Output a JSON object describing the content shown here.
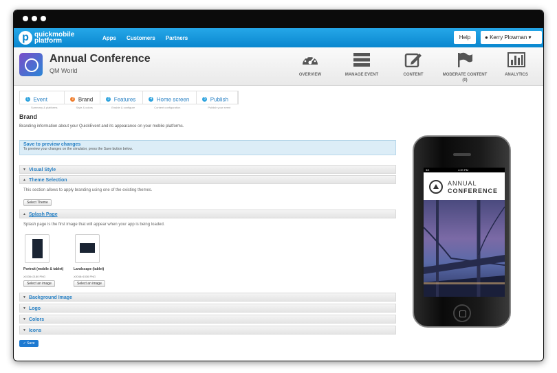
{
  "nav": {
    "logo_text_1": "quickmobile",
    "logo_text_2": "platform",
    "links": [
      "Apps",
      "Customers",
      "Partners"
    ],
    "help": "Help",
    "user": "Kerry Plowman ▾"
  },
  "header": {
    "title": "Annual Conference",
    "subtitle": "QM World",
    "nav": [
      {
        "label": "OVERVIEW",
        "icon": "gauge-icon"
      },
      {
        "label": "MANAGE EVENT",
        "icon": "list-icon"
      },
      {
        "label": "CONTENT",
        "icon": "pencil-icon"
      },
      {
        "label": "MODERATE CONTENT (0)",
        "icon": "flag-icon"
      },
      {
        "label": "ANALYTICS",
        "icon": "bar-chart-icon"
      }
    ]
  },
  "steps": [
    {
      "num": "1",
      "title": "Event",
      "sub": "Summary & platforms"
    },
    {
      "num": "2",
      "title": "Brand",
      "sub": "Style & colors"
    },
    {
      "num": "3",
      "title": "Features",
      "sub": "Enable & configure"
    },
    {
      "num": "4",
      "title": "Home screen",
      "sub": "Content configuration"
    },
    {
      "num": "5",
      "title": "Publish",
      "sub": "Publish your event"
    }
  ],
  "brand": {
    "heading": "Brand",
    "description": "Branding information about your QuickEvent and its appearance on your mobile platforms.",
    "preview_title": "Save to preview changes",
    "preview_text": "To preview your changes on the simulator, press the Save button below."
  },
  "sections": {
    "visual_style": "Visual Style",
    "theme_selection": "Theme Selection",
    "theme_text": "This section allows to apply branding using one of the existing themes.",
    "select_theme": "Select Theme",
    "splash_page": "Splash Page",
    "splash_text": "Splash page is the first image that will appear when your app is being loaded.",
    "portrait_label": "Portrait (mobile & tablet)",
    "portrait_size": "≥1536×2180 PNG",
    "landscape_label": "Landscape (tablet)",
    "landscape_size": "≥2048×1536 PNG",
    "select_image": "Select an image",
    "background_image": "Background Image",
    "logo": "Logo",
    "colors": "Colors",
    "icons": "Icons",
    "save": "✓ Save"
  },
  "phone": {
    "carrier": "3G",
    "time": "4:20 PM",
    "line1": "ANNUAL",
    "line2": "CONFERENCE"
  }
}
